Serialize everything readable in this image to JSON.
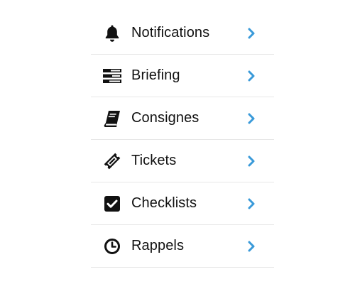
{
  "accent_color": "#3a9ad9",
  "menu": {
    "items": [
      {
        "label": "Notifications",
        "icon": "bell-icon"
      },
      {
        "label": "Briefing",
        "icon": "list-bars-icon"
      },
      {
        "label": "Consignes",
        "icon": "book-icon"
      },
      {
        "label": "Tickets",
        "icon": "ticket-icon"
      },
      {
        "label": "Checklists",
        "icon": "checkbox-icon"
      },
      {
        "label": "Rappels",
        "icon": "clock-icon"
      }
    ]
  }
}
